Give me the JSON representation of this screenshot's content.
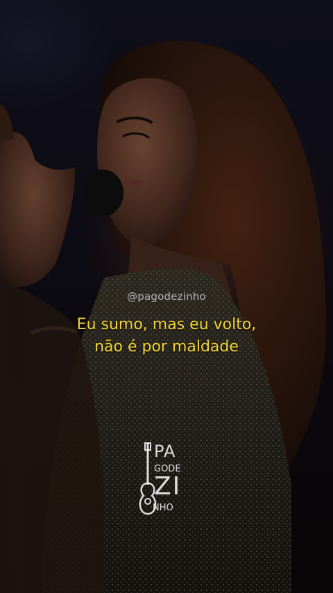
{
  "watermark": "@pagodezinho",
  "lyrics": {
    "line1": "Eu sumo, mas eu volto,",
    "line2": "não é por maldade"
  },
  "logo": {
    "line1": "PA",
    "line2": "GODE",
    "line3": "ZI",
    "line4": "NHO"
  },
  "colors": {
    "lyric": "#f2d335",
    "watermark": "#e6e6e6"
  }
}
